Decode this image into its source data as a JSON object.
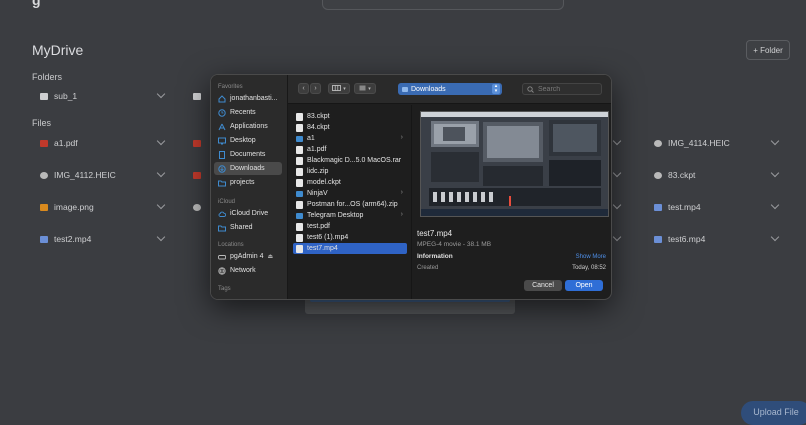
{
  "background": {
    "page_title": "MyDrive",
    "add_folder_label": "+ Folder",
    "folders_label": "Folders",
    "files_label": "Files",
    "folders": [
      {
        "name": "sub_1",
        "icon": "folder-icon"
      }
    ],
    "file_cards": [
      {
        "name": "a1.pdf",
        "icon": "pdf-icon",
        "color": "#c0392b"
      },
      {
        "name": "IMG_4114.HEIC",
        "icon": "info-icon",
        "color": "#b9b9b9"
      },
      {
        "name": "IMG_4112.HEIC",
        "icon": "info-icon",
        "color": "#b9b9b9"
      },
      {
        "name": "83.ckpt",
        "icon": "info-icon",
        "color": "#b9b9b9"
      },
      {
        "name": "image.png",
        "icon": "image-icon",
        "color": "#d98a1e"
      },
      {
        "name": "test.mp4",
        "icon": "video-icon",
        "color": "#6b8fd6"
      },
      {
        "name": "test2.mp4",
        "icon": "video-icon",
        "color": "#6b8fd6"
      },
      {
        "name": "test6.mp4",
        "icon": "video-icon",
        "color": "#6b8fd6"
      }
    ],
    "upload_label": "Upload File"
  },
  "dialog": {
    "sidebar": {
      "favorites_label": "Favorites",
      "favorites": [
        {
          "label": "jonathanbasti...",
          "icon": "home-icon"
        },
        {
          "label": "Recents",
          "icon": "clock-icon"
        },
        {
          "label": "Applications",
          "icon": "applications-icon"
        },
        {
          "label": "Desktop",
          "icon": "desktop-icon"
        },
        {
          "label": "Documents",
          "icon": "document-icon"
        },
        {
          "label": "Downloads",
          "icon": "downloads-icon"
        },
        {
          "label": "projects",
          "icon": "folder-icon"
        }
      ],
      "icloud_label": "iCloud",
      "icloud": [
        {
          "label": "iCloud Drive",
          "icon": "cloud-icon"
        },
        {
          "label": "Shared",
          "icon": "shared-folder-icon"
        }
      ],
      "locations_label": "Locations",
      "locations": [
        {
          "label": "pgAdmin 4",
          "icon": "drive-icon"
        },
        {
          "label": "Network",
          "icon": "globe-icon"
        }
      ],
      "tags_label": "Tags",
      "selected": "Downloads"
    },
    "toolbar": {
      "location": "Downloads",
      "search_placeholder": "Search"
    },
    "files": [
      {
        "name": "83.ckpt",
        "kind": "doc"
      },
      {
        "name": "84.ckpt",
        "kind": "doc"
      },
      {
        "name": "a1",
        "kind": "folder",
        "has_children": true
      },
      {
        "name": "a1.pdf",
        "kind": "doc"
      },
      {
        "name": "Blackmagic D...5.0 MacOS.rar",
        "kind": "doc"
      },
      {
        "name": "lidc.zip",
        "kind": "doc"
      },
      {
        "name": "model.ckpt",
        "kind": "doc"
      },
      {
        "name": "NinjaV",
        "kind": "folder",
        "has_children": true
      },
      {
        "name": "Postman for...OS (arm64).zip",
        "kind": "doc"
      },
      {
        "name": "Telegram Desktop",
        "kind": "folder",
        "has_children": true
      },
      {
        "name": "test.pdf",
        "kind": "doc"
      },
      {
        "name": "test6 (1).mp4",
        "kind": "vid"
      },
      {
        "name": "test7.mp4",
        "kind": "vid"
      }
    ],
    "selected_file": "test7.mp4",
    "more_glyph": "›",
    "preview": {
      "name": "test7.mp4",
      "kind": "MPEG-4 movie - 38.1 MB",
      "information_label": "Information",
      "show_more_label": "Show More",
      "created_label": "Created",
      "created_value": "Today, 08:52"
    },
    "buttons": {
      "cancel": "Cancel",
      "open": "Open"
    }
  },
  "colors": {
    "accent": "#2f6ed6",
    "selection": "#2f63c5",
    "folder": "#3f8bcf"
  }
}
